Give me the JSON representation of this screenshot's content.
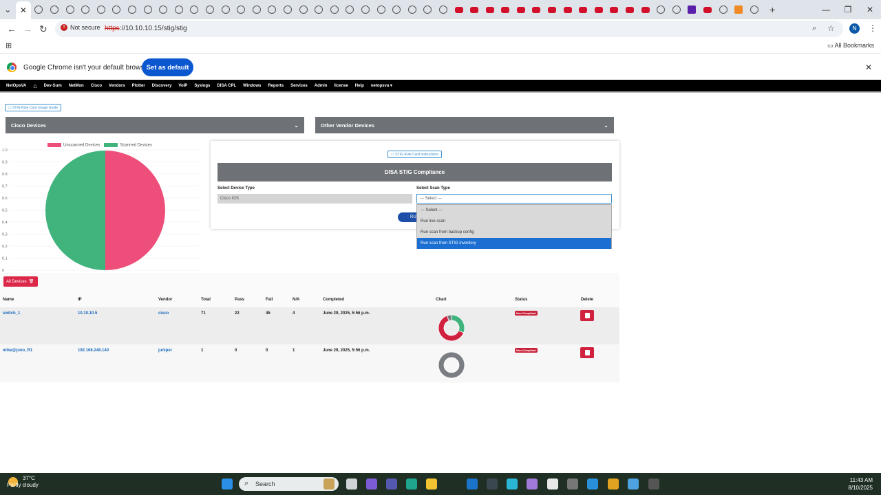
{
  "browser": {
    "tab_count": 50,
    "url_scheme": "https",
    "url_rest": "://10.10.10.15/stig/stig",
    "security_label": "Not secure",
    "profile_initial": "N",
    "bookmarks_label": "All Bookmarks",
    "infobar_text": "Google Chrome isn't your default browser",
    "set_default_label": "Set as default"
  },
  "app_nav": [
    "NetOpsVA",
    "Dev-Sum",
    "NetMon",
    "Cisco",
    "Vendors",
    "Plotter",
    "Discovery",
    "VoIP",
    "Syslogs",
    "DISA CPL",
    "Windows",
    "Reports",
    "Services",
    "Admin",
    "license",
    "Help",
    "netopsva"
  ],
  "page": {
    "guide_button": "STIG Rule Card Usage Guide",
    "cisco_accordion": "Cisco Devices",
    "other_accordion": "Other Vendor Devices",
    "instructions_button": "STIG Rule Card Instructions",
    "card_title": "DISA STIG Compliance",
    "device_type_label": "Select Device Type",
    "device_type_value": "Cisco IOS",
    "scan_type_label": "Select Scan Type",
    "scan_type_value": "--- Select ---",
    "run_label": "RU",
    "scan_options": [
      "--- Select ---",
      "Run live scan",
      "Run scan from backup config",
      "Run scan from STIG inventory"
    ],
    "all_devices_label": "All Devices"
  },
  "chart_data": {
    "type": "pie",
    "series": [
      {
        "name": "Unscanned Devices",
        "value": 1,
        "color": "#ee4f7a"
      },
      {
        "name": "Scanned Devices",
        "value": 1,
        "color": "#41b47e"
      }
    ],
    "y_ticks": [
      "1.0",
      "0.9",
      "0.8",
      "0.7",
      "0.6",
      "0.5",
      "0.4",
      "0.3",
      "0.2",
      "0.1",
      "0"
    ]
  },
  "table": {
    "headers": [
      "Name",
      "IP",
      "Vendor",
      "Total",
      "Pass",
      "Fail",
      "N/A",
      "Completed",
      "Chart",
      "Status",
      "Delete"
    ],
    "rows": [
      {
        "name": "switch_1",
        "ip": "10.10.10.5",
        "vendor": "cisco",
        "total": "71",
        "pass": "22",
        "fail": "45",
        "na": "4",
        "completed": "June 29, 2025, 5:56 p.m.",
        "status": "Non-Compliant",
        "donut": {
          "pass": 22,
          "fail": 45,
          "na": 4
        }
      },
      {
        "name": "mike@juno_R1",
        "ip": "192.168.248.140",
        "vendor": "juniper",
        "total": "1",
        "pass": "0",
        "fail": "0",
        "na": "1",
        "completed": "June 29, 2025, 5:56 p.m.",
        "status": "Non-Compliant",
        "donut": {
          "pass": 0,
          "fail": 0,
          "na": 1
        }
      }
    ]
  },
  "taskbar": {
    "temperature": "37°C",
    "weather": "Partly cloudy",
    "search_placeholder": "Search",
    "time": "11:43 AM",
    "date": "8/10/2025"
  }
}
